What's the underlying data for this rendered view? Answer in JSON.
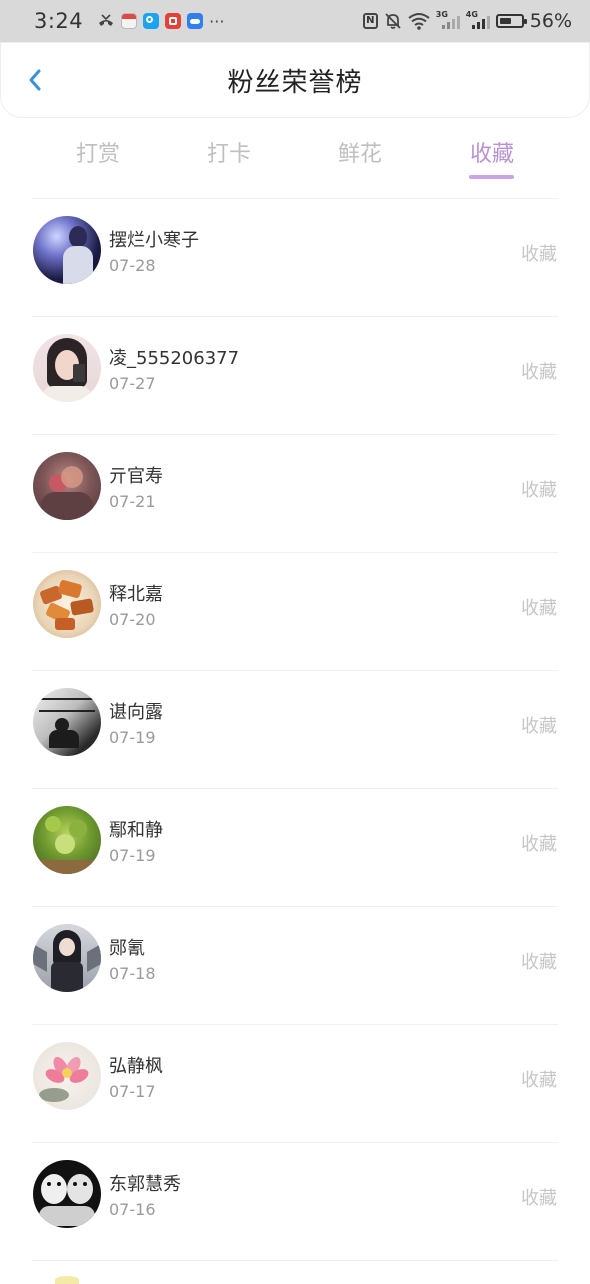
{
  "status_bar": {
    "time": "3:24",
    "battery_percent": "56%",
    "battery_level": 0.56,
    "left_icons": [
      "missed-call-icon",
      "calendar-app-icon",
      "search-app-icon",
      "notes-app-icon",
      "cloud-app-icon"
    ],
    "more": "···",
    "right_icons": [
      "nfc-icon",
      "mute-icon",
      "wifi-icon",
      "3g-signal-icon",
      "4g-signal-icon",
      "battery-icon"
    ],
    "net_3g": "3G",
    "net_4g": "4G",
    "nfc_glyph": "N",
    "mute_glyph": "🔕"
  },
  "header": {
    "title": "粉丝荣誉榜"
  },
  "tabs": [
    {
      "label": "打赏",
      "active": false
    },
    {
      "label": "打卡",
      "active": false
    },
    {
      "label": "鲜花",
      "active": false
    },
    {
      "label": "收藏",
      "active": true
    }
  ],
  "colors": {
    "accent": "#b993d6",
    "underline": "#c7a4e6",
    "back_arrow": "#3a8fe0",
    "muted": "#c6c6c6"
  },
  "fans": [
    {
      "name": "摆烂小寒子",
      "date": "07-28",
      "action": "收藏",
      "avatar": "night-figure-avatar"
    },
    {
      "name": "凌_555206377",
      "date": "07-27",
      "action": "收藏",
      "avatar": "selfie-girl-avatar"
    },
    {
      "name": "亓官寿",
      "date": "07-21",
      "action": "收藏",
      "avatar": "flower-portrait-avatar"
    },
    {
      "name": "释北嘉",
      "date": "07-20",
      "action": "收藏",
      "avatar": "food-dish-avatar"
    },
    {
      "name": "谌向露",
      "date": "07-19",
      "action": "收藏",
      "avatar": "bw-window-avatar"
    },
    {
      "name": "鄢和静",
      "date": "07-19",
      "action": "收藏",
      "avatar": "green-plant-avatar"
    },
    {
      "name": "郧氰",
      "date": "07-18",
      "action": "收藏",
      "avatar": "anime-girl-avatar"
    },
    {
      "name": "弘静枫",
      "date": "07-17",
      "action": "收藏",
      "avatar": "lotus-painting-avatar"
    },
    {
      "name": "东郭慧秀",
      "date": "07-16",
      "action": "收藏",
      "avatar": "tiger-sketch-avatar"
    }
  ]
}
